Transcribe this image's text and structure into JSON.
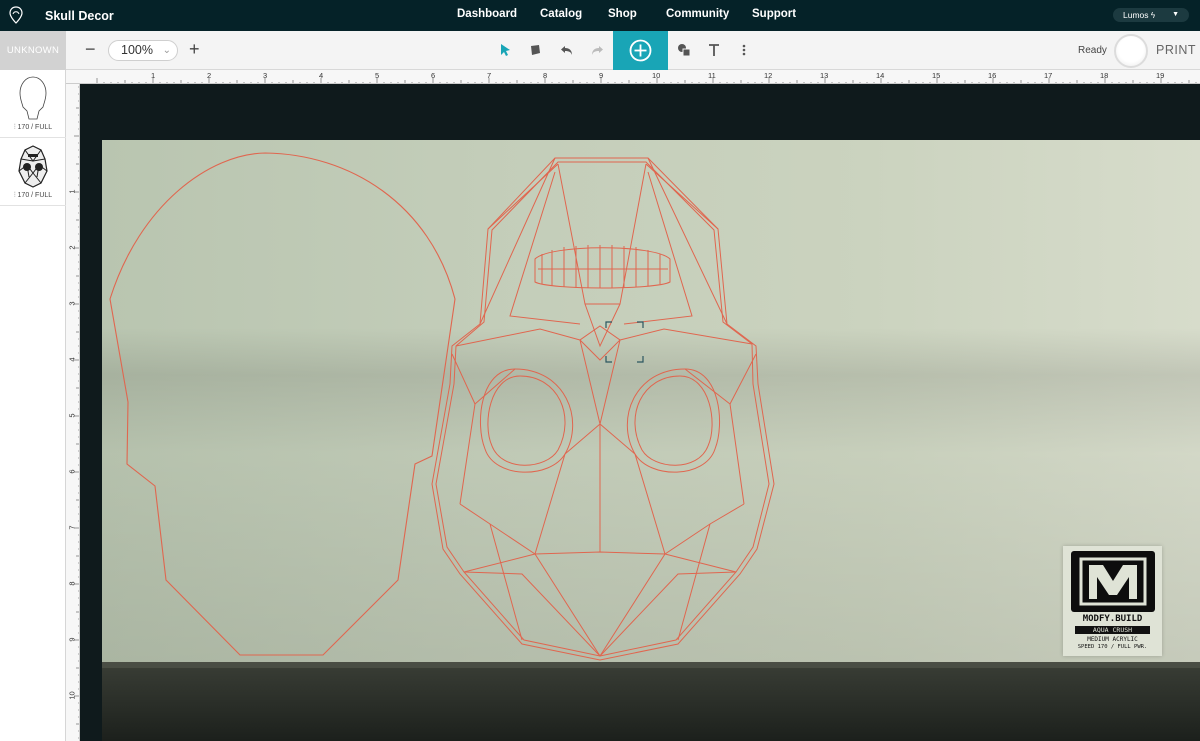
{
  "app": {
    "document_title": "Skull Decor",
    "nav_links": [
      "Dashboard",
      "Catalog",
      "Shop",
      "Community",
      "Support"
    ],
    "device_name": "Lumos",
    "device_icon": "bolt-icon"
  },
  "toolbar": {
    "material_tab": "UNKNOWN",
    "zoom_out": "−",
    "zoom_value": "100%",
    "zoom_in": "+",
    "tools": [
      "select-arrow-icon",
      "stamp-icon",
      "undo-icon",
      "redo-icon",
      "add-icon",
      "shapes-icon",
      "text-icon",
      "more-vertical-icon"
    ],
    "status": "Ready",
    "print_label": "PRINT",
    "accent_color": "#19a5b6"
  },
  "layers": [
    {
      "name": "skull-outline",
      "setting": "170 / FULL",
      "icon": "laser-icon"
    },
    {
      "name": "skull-geometric",
      "setting": "170 / FULL",
      "icon": "laser-icon"
    }
  ],
  "rulers": {
    "horizontal": [
      "1",
      "2",
      "3",
      "4",
      "5",
      "6",
      "7",
      "8",
      "9",
      "10",
      "11",
      "12",
      "13",
      "14",
      "15",
      "16",
      "17",
      "18",
      "19"
    ],
    "vertical": [
      "-1",
      "1",
      "2",
      "3",
      "4",
      "5",
      "6",
      "7",
      "8",
      "9",
      "10"
    ]
  },
  "material_card": {
    "brand": "MODFY.BUILD",
    "material": "AQUA CRUSH",
    "type": "MEDIUM ACRYLIC",
    "speed": "SPEED 170 / FULL PWR."
  },
  "colors": {
    "cut_line": "#e0664f",
    "nav_bg": "#052228"
  }
}
